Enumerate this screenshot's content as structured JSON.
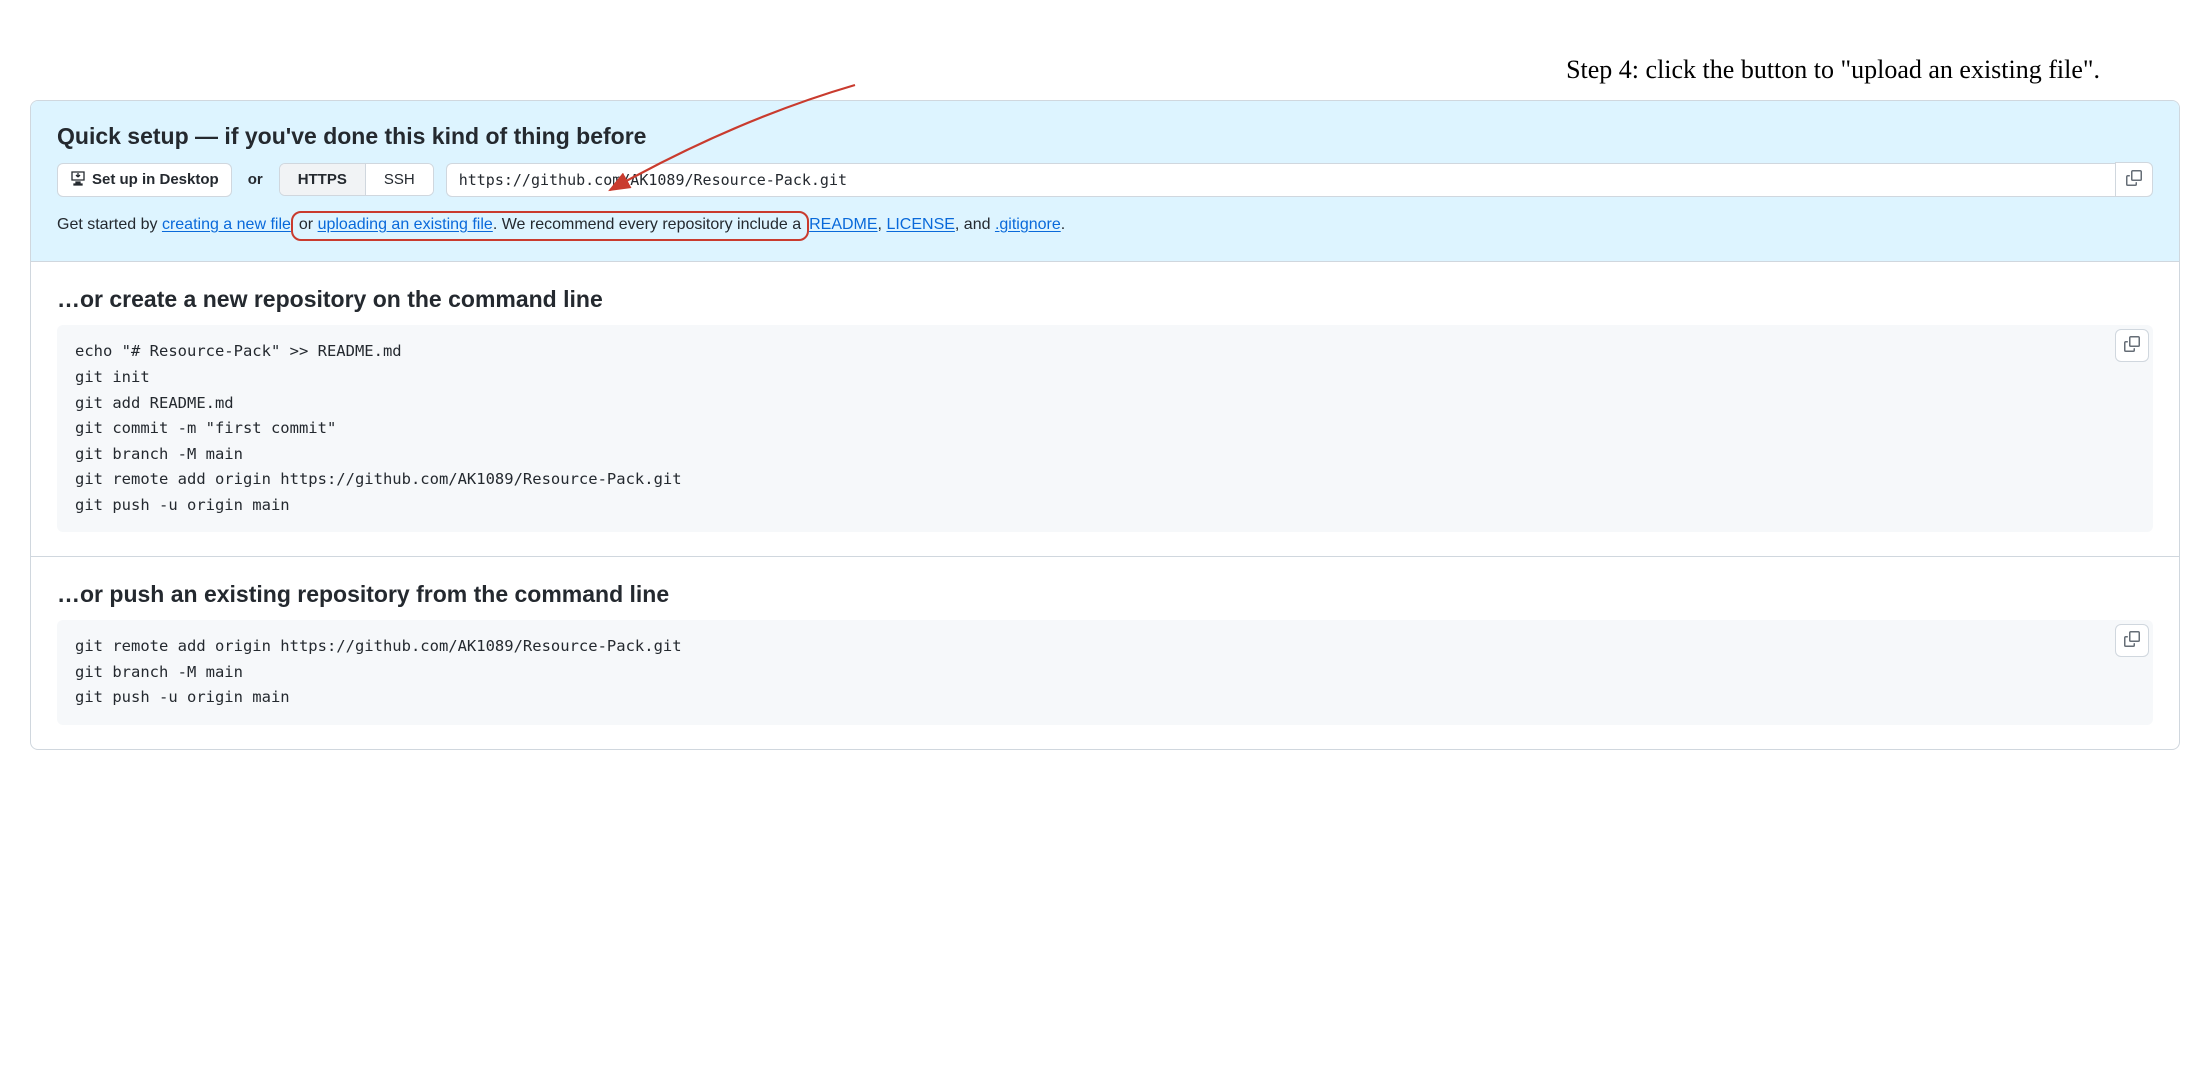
{
  "annotation": "Step 4: click the button to \"upload an existing file\".",
  "quick_setup": {
    "title": "Quick setup — if you've done this kind of thing before",
    "desktop_button": "Set up in Desktop",
    "or_label": "or",
    "tab_https": "HTTPS",
    "tab_ssh": "SSH",
    "clone_url": "https://github.com/AK1089/Resource-Pack.git",
    "helper_prefix": "Get started by ",
    "link_create": "creating a new file",
    "helper_or": " or ",
    "link_upload": "uploading an existing file",
    "helper_middle": ". We recommend every repository include a ",
    "link_readme": "README",
    "comma1": ", ",
    "link_license": "LICENSE",
    "comma2": ", and ",
    "link_gitignore": ".gitignore",
    "helper_end": "."
  },
  "create_section": {
    "title": "…or create a new repository on the command line",
    "code": "echo \"# Resource-Pack\" >> README.md\ngit init\ngit add README.md\ngit commit -m \"first commit\"\ngit branch -M main\ngit remote add origin https://github.com/AK1089/Resource-Pack.git\ngit push -u origin main"
  },
  "push_section": {
    "title": "…or push an existing repository from the command line",
    "code": "git remote add origin https://github.com/AK1089/Resource-Pack.git\ngit branch -M main\ngit push -u origin main"
  }
}
